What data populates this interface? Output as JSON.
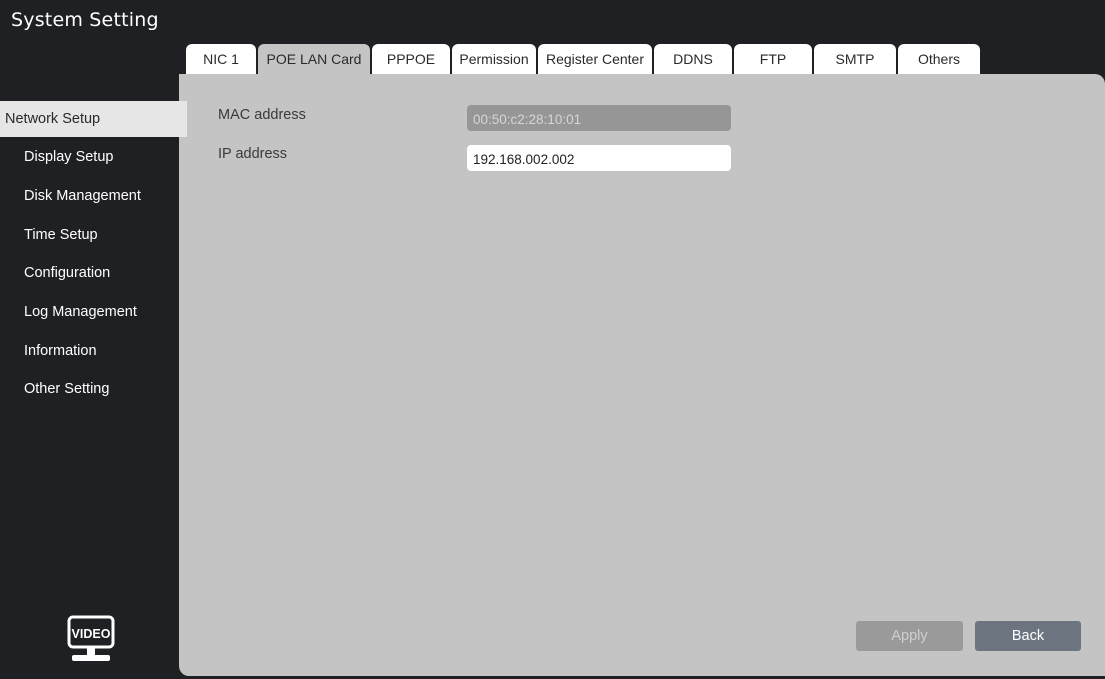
{
  "window": {
    "title": "System Setting"
  },
  "tabs": [
    {
      "label": "NIC 1",
      "active": false
    },
    {
      "label": "POE LAN Card",
      "active": true
    },
    {
      "label": "PPPOE",
      "active": false
    },
    {
      "label": "Permission",
      "active": false
    },
    {
      "label": "Register Center",
      "active": false
    },
    {
      "label": "DDNS",
      "active": false
    },
    {
      "label": "FTP",
      "active": false
    },
    {
      "label": "SMTP",
      "active": false
    },
    {
      "label": "Others",
      "active": false
    }
  ],
  "sidebar": {
    "items": [
      {
        "label": "Network Setup",
        "active": true
      },
      {
        "label": "Display Setup"
      },
      {
        "label": "Disk Management"
      },
      {
        "label": "Time Setup"
      },
      {
        "label": "Configuration"
      },
      {
        "label": "Log Management"
      },
      {
        "label": "Information"
      },
      {
        "label": "Other Setting"
      }
    ]
  },
  "form": {
    "mac": {
      "label": "MAC address",
      "value": "00:50:c2:28:10:01",
      "disabled": true
    },
    "ip": {
      "label": "IP address",
      "value": "192.168.002.002",
      "disabled": false
    }
  },
  "buttons": {
    "apply": "Apply",
    "back": "Back"
  },
  "logo": {
    "text": "VIDEO",
    "icon": "video-monitor-icon"
  },
  "colors": {
    "background": "#1e2023",
    "panel": "#c4c4c4",
    "tab": "#ffffff",
    "active_tab": "#c4c4c4",
    "disabled_field": "#969696",
    "back_button": "#6c7480",
    "apply_button_disabled": "#9a9a9a"
  }
}
